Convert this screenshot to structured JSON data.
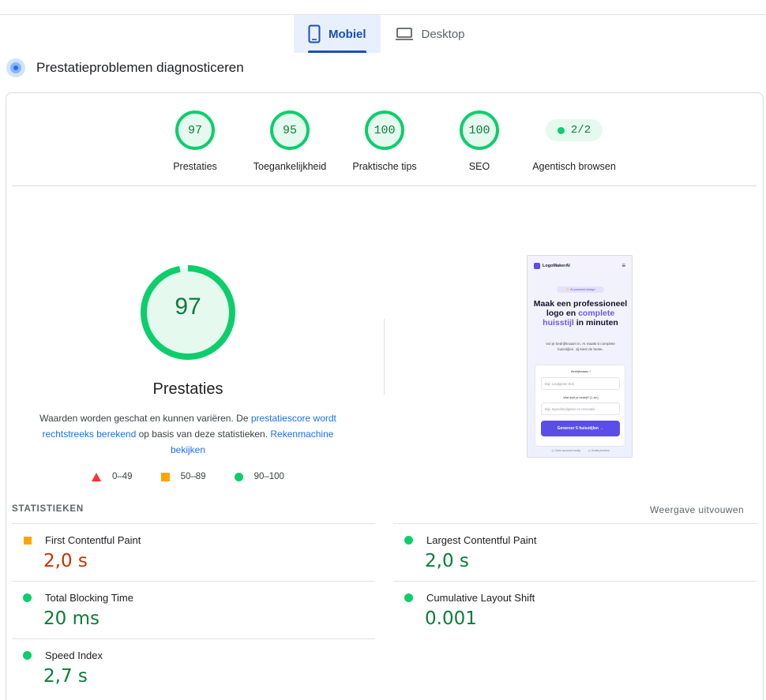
{
  "tabs": [
    {
      "label": "Mobiel",
      "icon": "phone-icon",
      "active": true
    },
    {
      "label": "Desktop",
      "icon": "laptop-icon",
      "active": false
    }
  ],
  "section_title": "Prestatieproblemen diagnosticeren",
  "categories": [
    {
      "score": "97",
      "label": "Prestaties"
    },
    {
      "score": "95",
      "label": "Toegankelijkheid"
    },
    {
      "score": "100",
      "label": "Praktische tips"
    },
    {
      "score": "100",
      "label": "SEO"
    },
    {
      "score": "2/2",
      "label": "Agentisch browsen"
    }
  ],
  "performance": {
    "score": "97",
    "score_fraction": 0.97,
    "title": "Prestaties",
    "desc_part1": "Waarden worden geschat en kunnen variëren. De ",
    "desc_link1": "prestatiescore wordt rechtstreeks berekend",
    "desc_part2": " op basis van deze statistieken. ",
    "desc_link2": "Rekenmachine bekijken"
  },
  "legend": [
    {
      "shape": "triangle",
      "color": "#ff3333",
      "label": "0–49"
    },
    {
      "shape": "square",
      "color": "#ffa400",
      "label": "50–89"
    },
    {
      "shape": "circle",
      "color": "#0cce6b",
      "label": "90–100"
    }
  ],
  "screenshot": {
    "brand": "LogoMakerAI",
    "badge": "✨ AI-powered design",
    "heading_1": "Maak een professioneel logo en ",
    "heading_highlight": "complete huisstijl",
    "heading_2": " in minuten",
    "subtext": "Vul je bedrijfsnaam in. AI maakt 5 complete huisstijlen. Jij kiest de beste.",
    "field1_label": "Bedrijfsnaam *",
    "field1_placeholder": "Bijv. Loodgieter Bos",
    "field2_label": "Wat doet je bedrijf? (1 zin)",
    "field2_placeholder": "Bijv. Spoedloodgieter en renovatie",
    "button": "Genereer 5 huisstijlen →",
    "foot1": "◎ Geen account nodig",
    "foot2": "◎ Gratis preview"
  },
  "statistics": {
    "header": "STATISTIEKEN",
    "expand_label": "Weergave uitvouwen",
    "metrics": [
      {
        "name": "First Contentful Paint",
        "value": "2,0 s",
        "rating": "average"
      },
      {
        "name": "Largest Contentful Paint",
        "value": "2,0 s",
        "rating": "good"
      },
      {
        "name": "Total Blocking Time",
        "value": "20 ms",
        "rating": "good"
      },
      {
        "name": "Cumulative Layout Shift",
        "value": "0.001",
        "rating": "good"
      },
      {
        "name": "Speed Index",
        "value": "2,7 s",
        "rating": "good"
      }
    ]
  },
  "colors": {
    "good": "#0cce6b",
    "average": "#ffa400",
    "poor": "#ff3333",
    "accent": "#1a4fb4"
  }
}
